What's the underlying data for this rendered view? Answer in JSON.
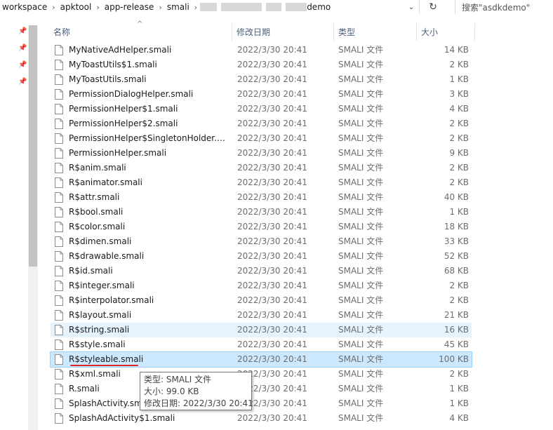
{
  "address": {
    "crumbs": [
      "workspace",
      "apktool",
      "app-release",
      "smali"
    ],
    "redacted_suffix": "demo"
  },
  "search": {
    "placeholder": "搜索\"asdkdemo\""
  },
  "columns": {
    "name": "名称",
    "date": "修改日期",
    "type": "类型",
    "size": "大小"
  },
  "files": [
    {
      "name": "MyNativeAdHelper.smali",
      "date": "2022/3/30 20:41",
      "type": "SMALI 文件",
      "size": "14 KB"
    },
    {
      "name": "MyToastUtils$1.smali",
      "date": "2022/3/30 20:41",
      "type": "SMALI 文件",
      "size": "2 KB"
    },
    {
      "name": "MyToastUtils.smali",
      "date": "2022/3/30 20:41",
      "type": "SMALI 文件",
      "size": "1 KB"
    },
    {
      "name": "PermissionDialogHelper.smali",
      "date": "2022/3/30 20:41",
      "type": "SMALI 文件",
      "size": "3 KB"
    },
    {
      "name": "PermissionHelper$1.smali",
      "date": "2022/3/30 20:41",
      "type": "SMALI 文件",
      "size": "4 KB"
    },
    {
      "name": "PermissionHelper$2.smali",
      "date": "2022/3/30 20:41",
      "type": "SMALI 文件",
      "size": "2 KB"
    },
    {
      "name": "PermissionHelper$SingletonHolder.s...",
      "date": "2022/3/30 20:41",
      "type": "SMALI 文件",
      "size": "2 KB"
    },
    {
      "name": "PermissionHelper.smali",
      "date": "2022/3/30 20:41",
      "type": "SMALI 文件",
      "size": "9 KB"
    },
    {
      "name": "R$anim.smali",
      "date": "2022/3/30 20:41",
      "type": "SMALI 文件",
      "size": "2 KB"
    },
    {
      "name": "R$animator.smali",
      "date": "2022/3/30 20:41",
      "type": "SMALI 文件",
      "size": "2 KB"
    },
    {
      "name": "R$attr.smali",
      "date": "2022/3/30 20:41",
      "type": "SMALI 文件",
      "size": "40 KB"
    },
    {
      "name": "R$bool.smali",
      "date": "2022/3/30 20:41",
      "type": "SMALI 文件",
      "size": "1 KB"
    },
    {
      "name": "R$color.smali",
      "date": "2022/3/30 20:41",
      "type": "SMALI 文件",
      "size": "18 KB"
    },
    {
      "name": "R$dimen.smali",
      "date": "2022/3/30 20:41",
      "type": "SMALI 文件",
      "size": "33 KB"
    },
    {
      "name": "R$drawable.smali",
      "date": "2022/3/30 20:41",
      "type": "SMALI 文件",
      "size": "52 KB"
    },
    {
      "name": "R$id.smali",
      "date": "2022/3/30 20:41",
      "type": "SMALI 文件",
      "size": "68 KB"
    },
    {
      "name": "R$integer.smali",
      "date": "2022/3/30 20:41",
      "type": "SMALI 文件",
      "size": "2 KB"
    },
    {
      "name": "R$interpolator.smali",
      "date": "2022/3/30 20:41",
      "type": "SMALI 文件",
      "size": "2 KB"
    },
    {
      "name": "R$layout.smali",
      "date": "2022/3/30 20:41",
      "type": "SMALI 文件",
      "size": "21 KB"
    },
    {
      "name": "R$string.smali",
      "date": "2022/3/30 20:41",
      "type": "SMALI 文件",
      "size": "16 KB",
      "state": "hover"
    },
    {
      "name": "R$style.smali",
      "date": "2022/3/30 20:41",
      "type": "SMALI 文件",
      "size": "45 KB"
    },
    {
      "name": "R$styleable.smali",
      "date": "2022/3/30 20:41",
      "type": "SMALI 文件",
      "size": "100 KB",
      "state": "selected"
    },
    {
      "name": "R$xml.smali",
      "date": "2022/3/30 20:41",
      "type": "SMALI 文件",
      "size": "2 KB"
    },
    {
      "name": "R.smali",
      "date": "2022/3/30 20:41",
      "type": "SMALI 文件",
      "size": "1 KB"
    },
    {
      "name": "SplashActivity.smali",
      "date": "2022/3/30 20:41",
      "type": "SMALI 文件",
      "size": "1 KB"
    },
    {
      "name": "SplashAdActivity$1.smali",
      "date": "2022/3/30 20:41",
      "type": "SMALI 文件",
      "size": "4 KB"
    }
  ],
  "tooltip": {
    "type_line": "类型: SMALI 文件",
    "size_line": "大小: 99.0 KB",
    "date_line": "修改日期: 2022/3/30 20:41"
  },
  "colors": {
    "selection": "#cce8ff",
    "hover": "#e5f3ff",
    "annotation_underline": "#e0252a",
    "header_text": "#4c607a"
  }
}
